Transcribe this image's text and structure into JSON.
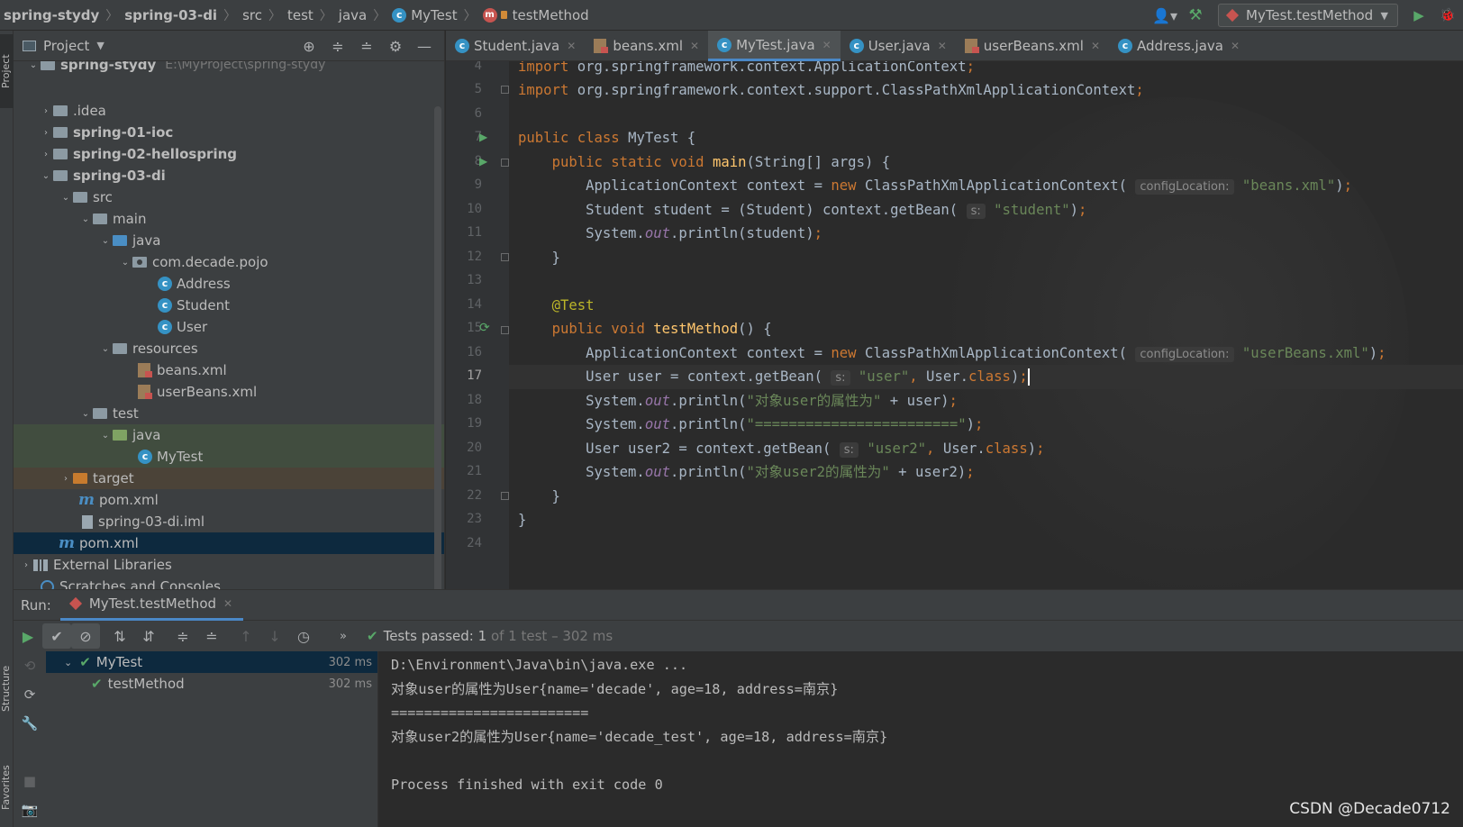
{
  "navbar": {
    "crumbs": [
      "spring-stydy",
      "spring-03-di",
      "src",
      "test",
      "java",
      "MyTest",
      "testMethod"
    ],
    "run_config": "MyTest.testMethod"
  },
  "sidebar": {
    "project_tab": "Project",
    "structure_tab": "Structure",
    "favorites_tab": "Favorites"
  },
  "project": {
    "title": "Project",
    "tree": [
      {
        "label": "spring-stydy",
        "note": "E:\\MyProject\\spring-stydy"
      },
      {
        "label": ".idea"
      },
      {
        "label": "spring-01-ioc"
      },
      {
        "label": "spring-02-hellospring"
      },
      {
        "label": "spring-03-di"
      },
      {
        "label": "src"
      },
      {
        "label": "main"
      },
      {
        "label": "java"
      },
      {
        "label": "com.decade.pojo"
      },
      {
        "label": "Address"
      },
      {
        "label": "Student"
      },
      {
        "label": "User"
      },
      {
        "label": "resources"
      },
      {
        "label": "beans.xml"
      },
      {
        "label": "userBeans.xml"
      },
      {
        "label": "test"
      },
      {
        "label": "java"
      },
      {
        "label": "MyTest"
      },
      {
        "label": "target"
      },
      {
        "label": "pom.xml"
      },
      {
        "label": "spring-03-di.iml"
      },
      {
        "label": "pom.xml"
      },
      {
        "label": "External Libraries"
      },
      {
        "label": "Scratches and Consoles"
      }
    ]
  },
  "editor": {
    "tabs": [
      "Student.java",
      "beans.xml",
      "MyTest.java",
      "User.java",
      "userBeans.xml",
      "Address.java"
    ],
    "active_tab": "MyTest.java",
    "current_line": 17,
    "line_numbers": [
      "4",
      "5",
      "6",
      "7",
      "8",
      "9",
      "10",
      "11",
      "12",
      "13",
      "14",
      "15",
      "16",
      "17",
      "18",
      "19",
      "20",
      "21",
      "22",
      "23",
      "24"
    ],
    "code": {
      "l4_pkg": "org.springframework.context.ApplicationContext",
      "l5_pkg": "org.springframework.context.support.ClassPathXmlApplicationContext",
      "class_name": "MyTest",
      "hint_config": "configLocation:",
      "hint_s": "s:",
      "beans_xml": "\"beans.xml\"",
      "student_str": "\"student\"",
      "annotation": "@Test",
      "method_name": "testMethod",
      "userbeans_xml": "\"userBeans.xml\"",
      "user_str": "\"user\"",
      "msg_user": "\"对象user的属性为\"",
      "separator_str": "\"========================\"",
      "user2_str": "\"user2\"",
      "msg_user2": "\"对象user2的属性为\""
    }
  },
  "run": {
    "label": "Run:",
    "tab": "MyTest.testMethod",
    "tests_passed": "Tests passed: 1",
    "tests_detail": "of 1 test – 302 ms",
    "tree": [
      {
        "label": "MyTest",
        "time": "302 ms"
      },
      {
        "label": "testMethod",
        "time": "302 ms"
      }
    ],
    "console": [
      "D:\\Environment\\Java\\bin\\java.exe ...",
      "对象user的属性为User{name='decade', age=18, address=南京}",
      "========================",
      "对象user2的属性为User{name='decade_test', age=18, address=南京}",
      "",
      "Process finished with exit code 0"
    ]
  },
  "watermark": "CSDN @Decade0712"
}
